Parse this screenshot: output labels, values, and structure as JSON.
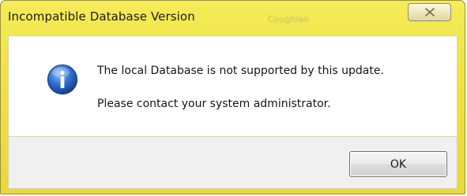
{
  "window": {
    "title": "Incompatible Database Version",
    "background_ghost_text": "Coughlan",
    "frame_color": "#efe244"
  },
  "titlebar": {
    "close_icon": "close-icon"
  },
  "message": {
    "icon": "information-icon",
    "line1": "The local Database is not supported by this update.",
    "line2": "Please contact your system administrator."
  },
  "footer": {
    "ok_label": "OK"
  }
}
